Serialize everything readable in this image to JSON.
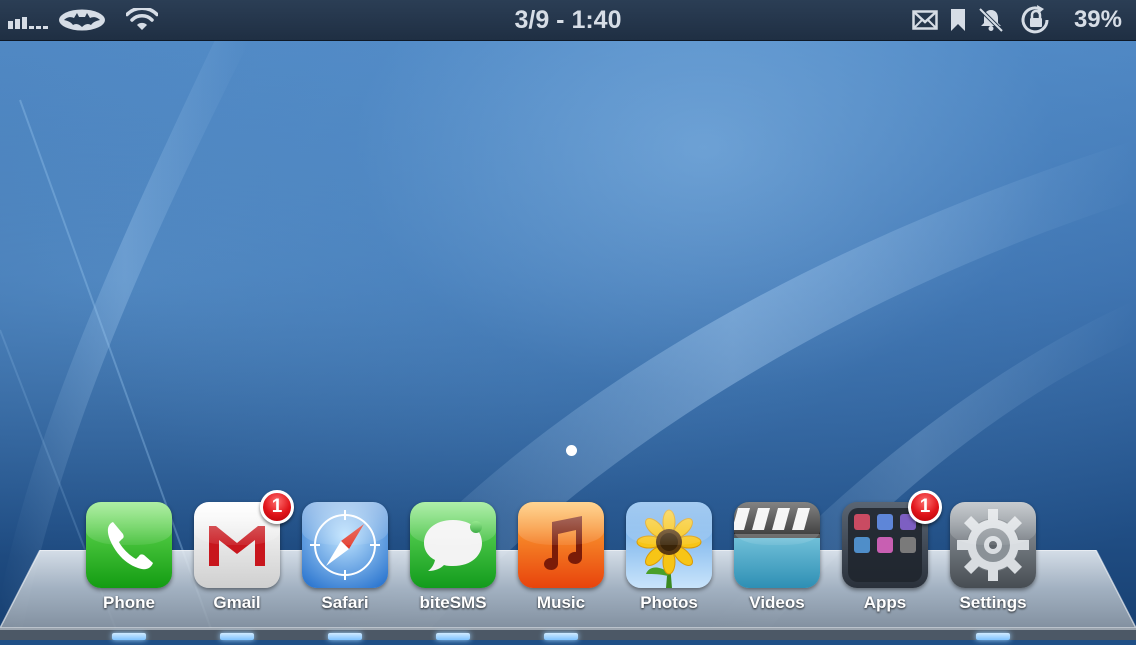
{
  "status_bar": {
    "time": "3/9 - 1:40",
    "battery_percent": "39%",
    "signal_bars": 3,
    "icons": [
      "signal-icon",
      "bat-logo-icon",
      "wifi-icon",
      "mail-icon",
      "bookmark-icon",
      "bell-muted-icon",
      "rotation-lock-icon"
    ]
  },
  "home": {
    "page_count": 1,
    "current_page": 1
  },
  "dock": {
    "apps": [
      {
        "label": "Phone",
        "icon": "phone-icon",
        "badge": ""
      },
      {
        "label": "Gmail",
        "icon": "gmail-icon",
        "badge": "1"
      },
      {
        "label": "Safari",
        "icon": "safari-compass-icon",
        "badge": ""
      },
      {
        "label": "biteSMS",
        "icon": "speech-bubble-icon",
        "badge": ""
      },
      {
        "label": "Music",
        "icon": "music-note-icon",
        "badge": ""
      },
      {
        "label": "Photos",
        "icon": "sunflower-icon",
        "badge": ""
      },
      {
        "label": "Videos",
        "icon": "clapperboard-icon",
        "badge": ""
      },
      {
        "label": "Apps",
        "icon": "folder-icon",
        "badge": "1"
      },
      {
        "label": "Settings",
        "icon": "gear-icon",
        "badge": ""
      }
    ]
  },
  "colors": {
    "badge_red": "#e0141a",
    "status_bar_bg": "#24364c",
    "wallpaper_blue": "#3a6eab"
  }
}
